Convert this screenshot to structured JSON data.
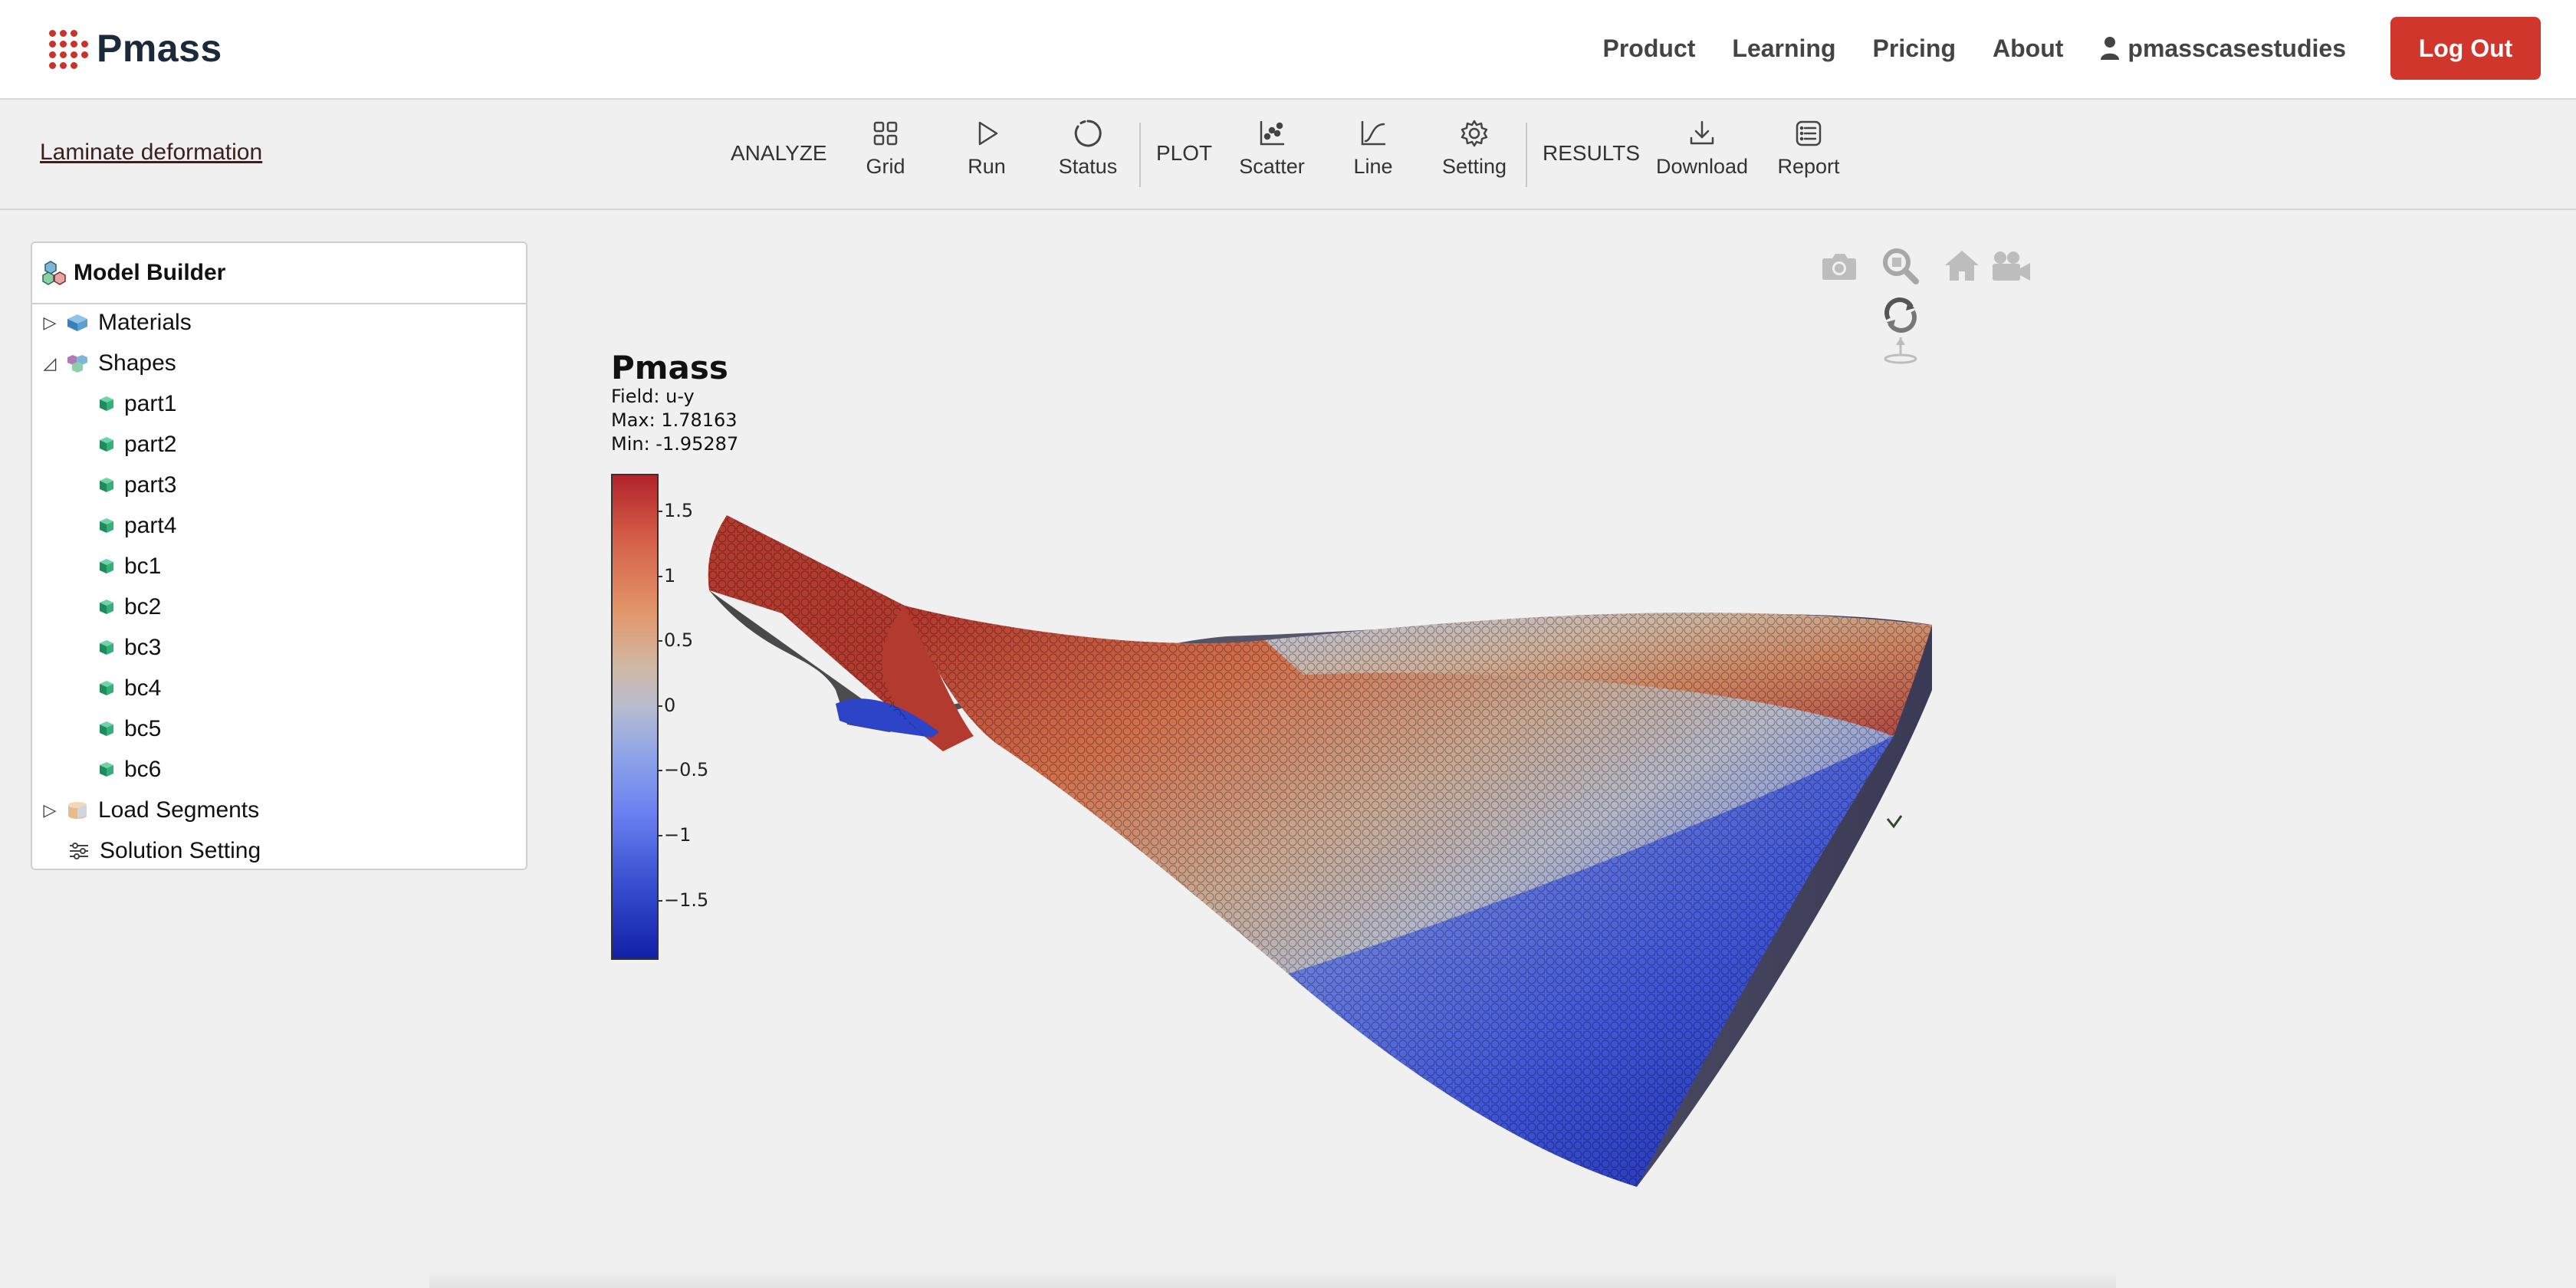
{
  "brand": {
    "name": "Pmass"
  },
  "nav": {
    "links": [
      "Product",
      "Learning",
      "Pricing",
      "About"
    ],
    "user": "pmasscasestudies",
    "logout": "Log Out"
  },
  "toolbar": {
    "project": "Laminate deformation",
    "groups": {
      "analyze": "ANALYZE",
      "plot": "PLOT",
      "results": "RESULTS"
    },
    "buttons": {
      "grid": "Grid",
      "run": "Run",
      "status": "Status",
      "scatter": "Scatter",
      "line": "Line",
      "setting": "Setting",
      "download": "Download",
      "report": "Report"
    }
  },
  "model_builder": {
    "title": "Model Builder",
    "items": {
      "materials": "Materials",
      "shapes": "Shapes",
      "load_segments": "Load Segments",
      "solution_setting": "Solution Setting"
    },
    "shapes": [
      "part1",
      "part2",
      "part3",
      "part4",
      "bc1",
      "bc2",
      "bc3",
      "bc4",
      "bc5",
      "bc6"
    ]
  },
  "viewer": {
    "icons": [
      "camera-icon",
      "zoom-icon",
      "home-icon",
      "video-camera-icon",
      "orbit-rotate-icon",
      "turntable-icon"
    ],
    "legend": {
      "title": "Pmass",
      "field": "Field: u-y",
      "max": "Max: 1.78163",
      "min": "Min: -1.95287",
      "ticks": [
        "1.5",
        "1",
        "0.5",
        "0",
        "−0.5",
        "−1",
        "−1.5"
      ]
    },
    "colors": {
      "high": "#b2222b",
      "mid": "#c8c8c8",
      "low": "#1020a8"
    }
  }
}
